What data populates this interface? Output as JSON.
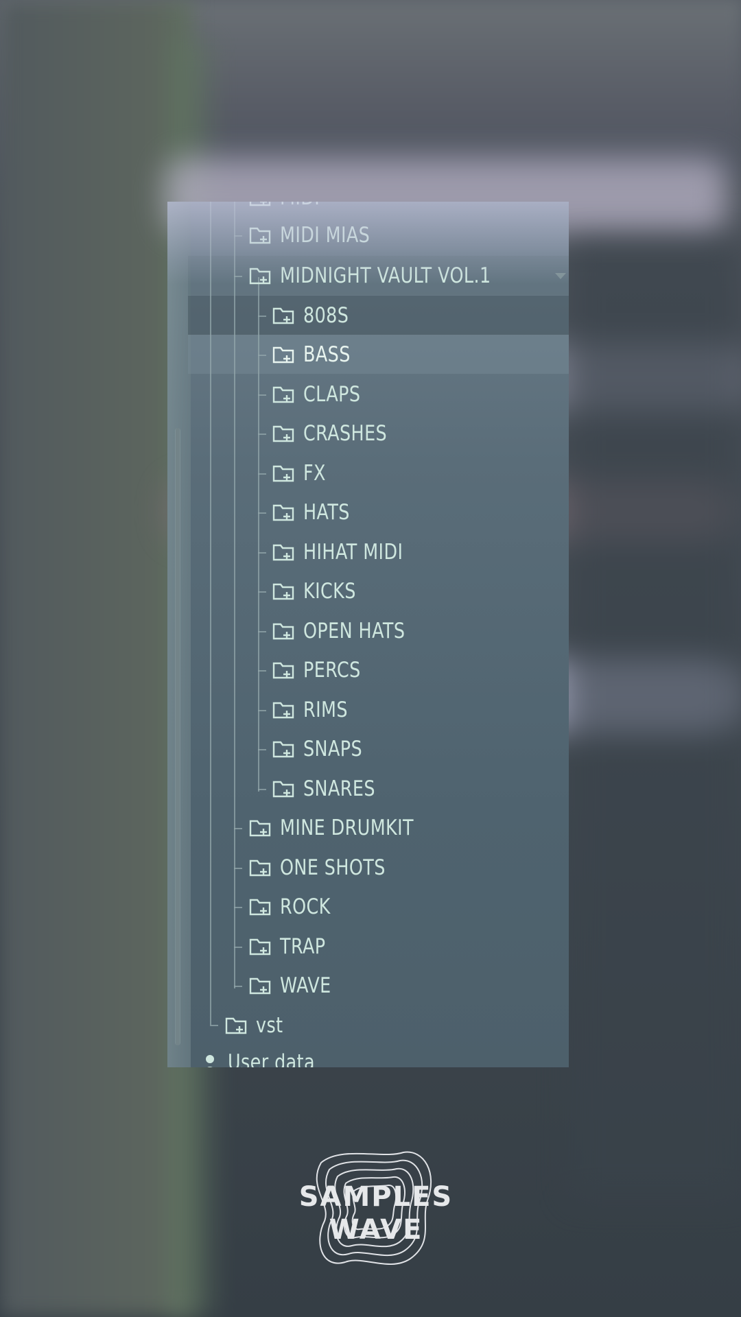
{
  "browser": {
    "top_items": [
      {
        "label": "MIDI",
        "level": 2
      },
      {
        "label": "MIDI MIAS",
        "level": 2
      },
      {
        "label": "MIDNIGHT VAULT VOL.1",
        "level": 2
      }
    ],
    "children": [
      {
        "label": "808S"
      },
      {
        "label": "BASS"
      },
      {
        "label": "CLAPS"
      },
      {
        "label": "CRASHES"
      },
      {
        "label": "FX"
      },
      {
        "label": "HATS"
      },
      {
        "label": "HIHAT MIDI"
      },
      {
        "label": "KICKS"
      },
      {
        "label": "OPEN HATS"
      },
      {
        "label": "PERCS"
      },
      {
        "label": "RIMS"
      },
      {
        "label": "SNAPS"
      },
      {
        "label": "SNARES"
      }
    ],
    "after_items": [
      {
        "label": "MINE DRUMKIT"
      },
      {
        "label": "ONE SHOTS"
      },
      {
        "label": "ROCK"
      },
      {
        "label": "TRAP"
      },
      {
        "label": "WAVE"
      }
    ],
    "vst_label": "vst",
    "user_data_label": "User data",
    "selected_item": "BASS"
  },
  "logo": {
    "line1": "SAMPLES",
    "line2": "WAVE"
  },
  "colors": {
    "text": "#cfe7df",
    "panel": "#56697a",
    "guide": "#93a7ab"
  }
}
